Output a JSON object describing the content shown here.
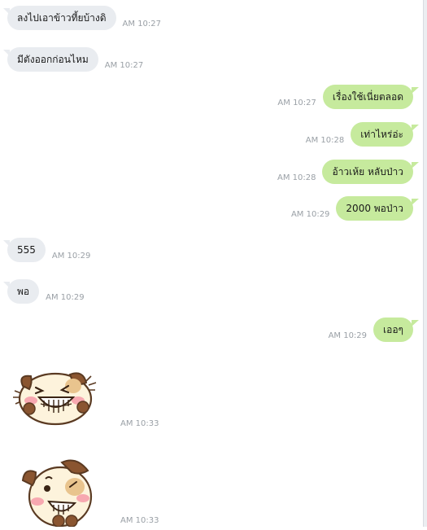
{
  "messages": [
    {
      "dir": "in",
      "text": "ลงไปเอาข้าวที้ยบ้างดิ",
      "time": "AM 10:27"
    },
    {
      "dir": "in",
      "text": "มีตังออกก่อนไหม",
      "time": "AM 10:27"
    },
    {
      "dir": "out",
      "text": "เรื่องใช้เนี่ยตลอด",
      "time": "AM 10:27"
    },
    {
      "dir": "out",
      "text": "เท่าไหร่อ่ะ",
      "time": "AM 10:28"
    },
    {
      "dir": "out",
      "text": "อ้าวเห้ย หลับป่าว",
      "time": "AM 10:28"
    },
    {
      "dir": "out",
      "text": "2000 พอป่าว",
      "time": "AM 10:29"
    },
    {
      "dir": "in",
      "text": "555",
      "time": "AM 10:29"
    },
    {
      "dir": "in",
      "text": "พอ",
      "time": "AM 10:29"
    },
    {
      "dir": "out",
      "text": "เออๆ",
      "time": "AM 10:29"
    }
  ],
  "stickers": [
    {
      "name": "laughing-dog-sticker",
      "time": "AM 10:33"
    },
    {
      "name": "smiling-dog-sticker",
      "time": "AM 10:33"
    }
  ]
}
